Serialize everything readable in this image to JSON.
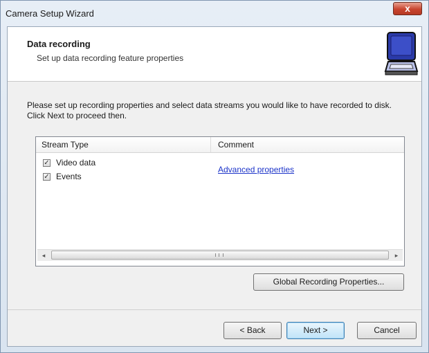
{
  "window": {
    "title": "Camera Setup Wizard",
    "close_glyph": "x"
  },
  "header": {
    "title": "Data recording",
    "subtitle": "Set up data recording feature properties",
    "icon": "camera-case-icon"
  },
  "instructions": "Please set up recording properties and select data streams you would like to have recorded to disk. Click Next to proceed then.",
  "list": {
    "columns": [
      "Stream Type",
      "Comment"
    ],
    "rows": [
      {
        "label": "Video data",
        "checked": true,
        "comment": "Advanced properties"
      },
      {
        "label": "Events",
        "checked": true,
        "comment": ""
      }
    ],
    "scroll_left": "◂",
    "scroll_right": "▸"
  },
  "buttons": {
    "global_recording": "Global Recording Properties...",
    "back": "< Back",
    "next": "Next >",
    "cancel": "Cancel"
  },
  "colors": {
    "link": "#1b33c9",
    "close": "#c8452f",
    "accent": "#3c7fb1"
  }
}
